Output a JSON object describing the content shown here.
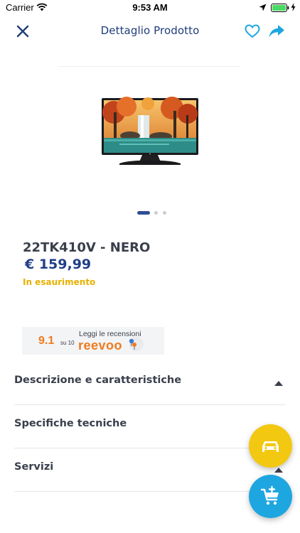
{
  "status_bar": {
    "carrier": "Carrier",
    "time": "9:53 AM",
    "icons": [
      "wifi-icon",
      "location-arrow-icon",
      "battery-icon",
      "charging-bolt-icon"
    ]
  },
  "nav": {
    "title": "Dettaglio Prodotto",
    "icons": [
      "close-icon",
      "heart-icon",
      "share-icon"
    ]
  },
  "product": {
    "name": "22TK410V - NERO",
    "price": "€ 159,99",
    "availability": "In esaurimento",
    "image_pages": 3,
    "image_current_page": 1
  },
  "reviews": {
    "score": "9.1",
    "out_of": "su 10",
    "cta": "Leggi le recensioni",
    "brand": "reevoo"
  },
  "sections": [
    {
      "label": "Descrizione e caratteristiche",
      "expanded": true
    },
    {
      "label": "Specifiche tecniche",
      "expanded": false
    },
    {
      "label": "Servizi",
      "expanded": true
    }
  ],
  "colors": {
    "accent_blue": "#1f3d7a",
    "price_blue": "#213f87",
    "warning_yellow": "#e7b100",
    "fab_yellow": "#f2c811",
    "fab_blue": "#1ea6e0",
    "reevoo_orange": "#ee7a1c"
  },
  "floating_actions": [
    {
      "name": "delivery",
      "icon": "car-icon"
    },
    {
      "name": "add-to-cart",
      "icon": "cart-plus-icon"
    }
  ]
}
